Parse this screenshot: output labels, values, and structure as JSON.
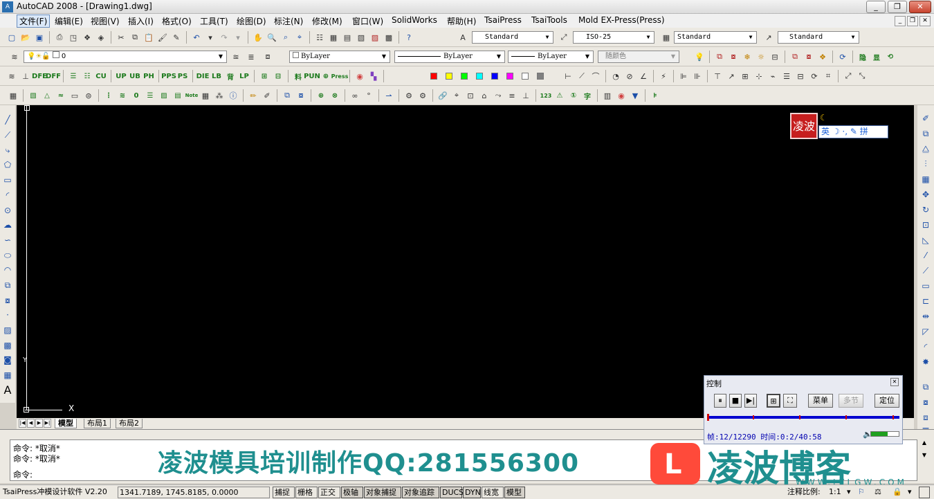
{
  "window": {
    "title": "AutoCAD 2008 - [Drawing1.dwg]",
    "app_icon": "autocad-icon",
    "buttons": {
      "minimize": "_",
      "maximize": "❐",
      "close": "✕"
    },
    "mdi_buttons": {
      "minimize": "_",
      "restore": "❐",
      "close": "✕"
    }
  },
  "menubar": {
    "items": [
      "文件(F)",
      "编辑(E)",
      "视图(V)",
      "插入(I)",
      "格式(O)",
      "工具(T)",
      "绘图(D)",
      "标注(N)",
      "修改(M)",
      "窗口(W)",
      "SolidWorks",
      "帮助(H)",
      "TsaiPress",
      "TsaiTools",
      "Mold EX-Press(Press)"
    ],
    "active_index": 0
  },
  "toolbars": {
    "text_style": "Standard",
    "dim_style": "ISO-25",
    "table_style": "Standard",
    "multileader_style": "Standard",
    "layer_name": "0",
    "color": "ByLayer",
    "linetype": "ByLayer",
    "lineweight": "ByLayer",
    "plot_style": "随颜色",
    "row3_labels": [
      "DFE",
      "DFF",
      "CU",
      "UP",
      "UB",
      "PH",
      "PPS",
      "PS",
      "DIE",
      "LB",
      "背",
      "LP",
      "料",
      "PUN",
      "Press"
    ],
    "row3_right_labels": [
      "隐",
      "显"
    ],
    "row4_labels": [
      "Note",
      "0",
      "123",
      "字"
    ],
    "palette_colors": [
      "#ff0000",
      "#ffff00",
      "#00ff00",
      "#00ffff",
      "#0000ff",
      "#ff00ff",
      "#ffffff",
      "#808080"
    ]
  },
  "canvas": {
    "background": "#000000",
    "ucs_x_label": "X",
    "ucs_y_label": "Y"
  },
  "layout_tabs": {
    "tabs": [
      "模型",
      "布局1",
      "布局2"
    ],
    "active": "模型"
  },
  "command": {
    "lines": [
      "命令: *取消*",
      "命令: *取消*"
    ],
    "prompt": "命令:"
  },
  "status": {
    "app_label": "TsaiPress冲模设计软件 V2.20",
    "coordinates": "1341.7189, 1745.8185, 0.0000",
    "toggles": [
      "捕捉",
      "栅格",
      "正交",
      "极轴",
      "对象捕捉",
      "对象追踪",
      "DUCS",
      "DYN",
      "线宽",
      "模型"
    ],
    "pressed": [
      "极轴",
      "对象捕捉",
      "对象追踪",
      "DUCS",
      "DYN",
      "模型"
    ],
    "annotation_scale_label": "注释比例:",
    "annotation_scale": "1:1"
  },
  "control_panel": {
    "title": "控制",
    "buttons": [
      "菜单",
      "多节",
      "定位"
    ],
    "disabled": [
      "多节"
    ],
    "frame_label": "帧:12/12290",
    "time_label": "时间:0:2/40:58",
    "progress_fraction": 0.001,
    "volume_fraction": 0.6
  },
  "ime": {
    "seal_text": "凌波",
    "bar_text": "英 ☽ ·, ✎ 拼"
  },
  "watermark": {
    "slogan": "凌波模具培训制作QQ:281556300",
    "logo_letter": "L",
    "logo_text": "凌波博客",
    "url": "WWW.LYLGW.COM"
  },
  "colors": {
    "brand_teal": "#1f8f8f",
    "logo_red": "#ff4a3a",
    "progress_blue": "#0000d0"
  }
}
